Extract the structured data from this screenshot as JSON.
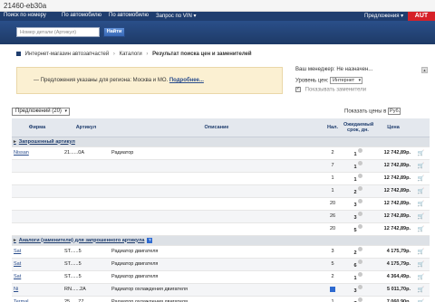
{
  "browser": {
    "url": "21460-eb30a"
  },
  "topbar": {
    "items": [
      "Поиск по номеру",
      "По автомобилю",
      "По автомобилю",
      "Запрос по VIN ▾",
      "Предложения ▾"
    ],
    "logo": "AUT"
  },
  "search": {
    "placeholder": "Номер детали (Артикул)",
    "button": "Найти"
  },
  "breadcrumb": {
    "items": [
      "Интернет-магазин автозапчастей",
      "Каталоги",
      "Результат поиска цен и заменителей"
    ]
  },
  "notice": {
    "text": "— Предложения указаны для региона: Москва и МО.",
    "link": "Подробнее..."
  },
  "side": {
    "manager": "Ваш менеджер: Не назначен...",
    "price_level_label": "Уровень цен:",
    "price_level_value": "Интернет",
    "show_replacements": "Показывать заменители"
  },
  "controls": {
    "offers": "Предложений (20)",
    "prices_label": "Показать цены в",
    "currency": "Руб."
  },
  "table": {
    "columns": [
      "Фирма",
      "Артикул",
      "Описание",
      "Нал.",
      "Ожидаемый срок, дн.",
      "Цена",
      ""
    ],
    "group1": "Запрошенный артикул",
    "group2": "Аналоги (заменители) для запрошенного артикула",
    "rows1": [
      {
        "brand": "Nissan",
        "article": "21......0A",
        "desc": "Радиатор",
        "stock": "2",
        "days": "1",
        "price": "12 742,89р."
      },
      {
        "brand": "",
        "article": "",
        "desc": "",
        "stock": "7",
        "days": "1",
        "price": "12 742,89р."
      },
      {
        "brand": "",
        "article": "",
        "desc": "",
        "stock": "1",
        "days": "1",
        "price": "12 742,89р."
      },
      {
        "brand": "",
        "article": "",
        "desc": "",
        "stock": "1",
        "days": "2",
        "price": "12 742,89р."
      },
      {
        "brand": "",
        "article": "",
        "desc": "",
        "stock": "20",
        "days": "3",
        "price": "12 742,89р."
      },
      {
        "brand": "",
        "article": "",
        "desc": "",
        "stock": "26",
        "days": "3",
        "price": "12 742,89р."
      },
      {
        "brand": "",
        "article": "",
        "desc": "",
        "stock": "20",
        "days": "5",
        "price": "12 742,89р."
      }
    ],
    "rows2": [
      {
        "brand": "Sat",
        "article": "ST......5",
        "desc": "Радиатор двигателя",
        "stock": "3",
        "days": "2",
        "price": "4 175,79р."
      },
      {
        "brand": "Sat",
        "article": "ST......5",
        "desc": "Радиатор двигателя",
        "stock": "5",
        "days": "6",
        "price": "4 175,79р."
      },
      {
        "brand": "Sat",
        "article": "ST......5",
        "desc": "Радиатор двигателя",
        "stock": "2",
        "days": "1",
        "price": "4 364,49р."
      },
      {
        "brand": "Ni",
        "article": "RN......2A",
        "desc": "Радиатор охлаждения двигателя",
        "stock": "",
        "days": "3",
        "price": "5 011,70р."
      },
      {
        "brand": "Termal",
        "article": "25......77",
        "desc": "Радиатор охлаждения двигателя",
        "stock": "1",
        "days": "7",
        "price": "7 060,90р."
      }
    ]
  }
}
